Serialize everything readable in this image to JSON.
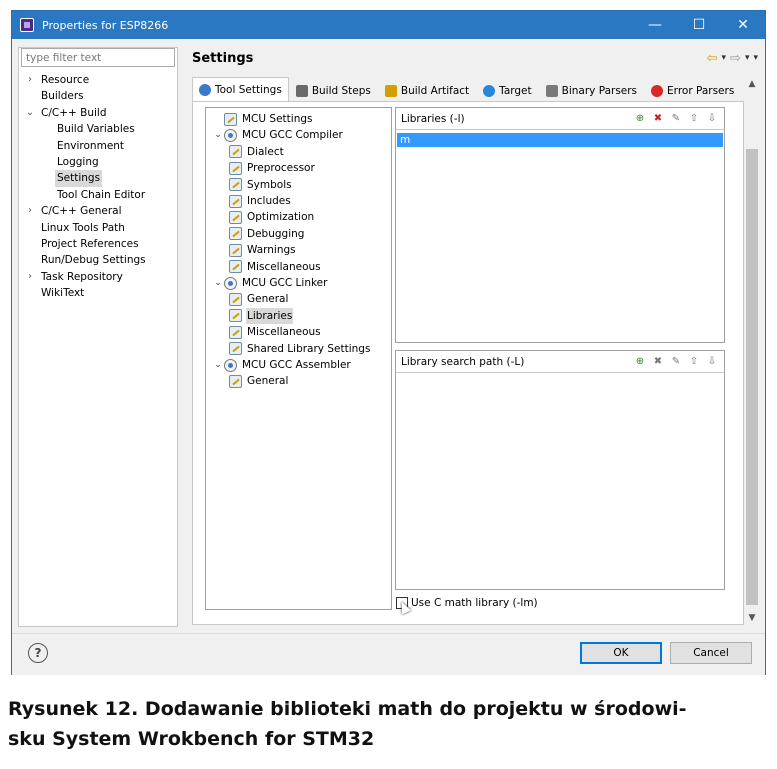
{
  "window": {
    "title": "Properties for ESP8266",
    "minimize": "—",
    "maximize": "☐",
    "close": "✕"
  },
  "filter": {
    "placeholder": "type filter text"
  },
  "nav": [
    {
      "label": "Resource",
      "arrow": "›",
      "level": 0
    },
    {
      "label": "Builders",
      "arrow": "",
      "level": 0
    },
    {
      "label": "C/C++ Build",
      "arrow": "⌄",
      "level": 0
    },
    {
      "label": "Build Variables",
      "arrow": "",
      "level": 1
    },
    {
      "label": "Environment",
      "arrow": "",
      "level": 1
    },
    {
      "label": "Logging",
      "arrow": "",
      "level": 1
    },
    {
      "label": "Settings",
      "arrow": "",
      "level": 1,
      "selected": true
    },
    {
      "label": "Tool Chain Editor",
      "arrow": "",
      "level": 1
    },
    {
      "label": "C/C++ General",
      "arrow": "›",
      "level": 0
    },
    {
      "label": "Linux Tools Path",
      "arrow": "",
      "level": 0
    },
    {
      "label": "Project References",
      "arrow": "",
      "level": 0
    },
    {
      "label": "Run/Debug Settings",
      "arrow": "",
      "level": 0
    },
    {
      "label": "Task Repository",
      "arrow": "›",
      "level": 0
    },
    {
      "label": "WikiText",
      "arrow": "",
      "level": 0
    }
  ],
  "settings": {
    "title": "Settings",
    "back_icon": "⇦",
    "forward_icon": "⇨",
    "dropdown_icon": "▾"
  },
  "tabs": [
    {
      "label": "Tool Settings",
      "icon": "gear-icon",
      "color": "#3a7ac8",
      "active": true
    },
    {
      "label": "Build Steps",
      "icon": "wrench-icon",
      "color": "#6a6a6a"
    },
    {
      "label": "Build Artifact",
      "icon": "trophy-icon",
      "color": "#d4a000"
    },
    {
      "label": "Target",
      "icon": "globe-icon",
      "color": "#2a86d8"
    },
    {
      "label": "Binary Parsers",
      "icon": "binary-icon",
      "color": "#7a7a7a"
    },
    {
      "label": "Error Parsers",
      "icon": "error-icon",
      "color": "#d42a2a"
    }
  ],
  "tool_tree": [
    {
      "label": "MCU Settings",
      "arrow": "",
      "level": 0,
      "icon": "settings-page"
    },
    {
      "label": "MCU GCC Compiler",
      "arrow": "⌄",
      "level": 0,
      "icon": "gear"
    },
    {
      "label": "Dialect",
      "arrow": "",
      "level": 1,
      "icon": "settings-page"
    },
    {
      "label": "Preprocessor",
      "arrow": "",
      "level": 1,
      "icon": "settings-page"
    },
    {
      "label": "Symbols",
      "arrow": "",
      "level": 1,
      "icon": "settings-page"
    },
    {
      "label": "Includes",
      "arrow": "",
      "level": 1,
      "icon": "settings-page"
    },
    {
      "label": "Optimization",
      "arrow": "",
      "level": 1,
      "icon": "settings-page"
    },
    {
      "label": "Debugging",
      "arrow": "",
      "level": 1,
      "icon": "settings-page"
    },
    {
      "label": "Warnings",
      "arrow": "",
      "level": 1,
      "icon": "settings-page"
    },
    {
      "label": "Miscellaneous",
      "arrow": "",
      "level": 1,
      "icon": "settings-page"
    },
    {
      "label": "MCU GCC Linker",
      "arrow": "⌄",
      "level": 0,
      "icon": "gear"
    },
    {
      "label": "General",
      "arrow": "",
      "level": 1,
      "icon": "settings-page"
    },
    {
      "label": "Libraries",
      "arrow": "",
      "level": 1,
      "icon": "settings-page",
      "selected": true
    },
    {
      "label": "Miscellaneous",
      "arrow": "",
      "level": 1,
      "icon": "settings-page"
    },
    {
      "label": "Shared Library Settings",
      "arrow": "",
      "level": 1,
      "icon": "settings-page"
    },
    {
      "label": "MCU GCC Assembler",
      "arrow": "⌄",
      "level": 0,
      "icon": "gear"
    },
    {
      "label": "General",
      "arrow": "",
      "level": 1,
      "icon": "settings-page"
    }
  ],
  "libraries": {
    "label": "Libraries (-l)",
    "items": [
      "m"
    ]
  },
  "search_path": {
    "label": "Library search path (-L)",
    "items": []
  },
  "list_tools": {
    "add": "⊕",
    "delete": "✖",
    "edit": "✎",
    "up": "⇧",
    "down": "⇩"
  },
  "math_checkbox": {
    "label": "Use C math library (-lm)",
    "checked": false
  },
  "scroll": {
    "up": "▲",
    "down": "▼"
  },
  "footer": {
    "help": "?",
    "ok": "OK",
    "cancel": "Cancel"
  },
  "caption": "Rysunek 12. Dodawanie biblioteki math do projektu w środowi-sku System Wrokbench for STM32",
  "caption_lines": [
    "Rysunek 12. Dodawanie biblioteki math do projektu w środowi-",
    "sku System Wrokbench for STM32"
  ]
}
